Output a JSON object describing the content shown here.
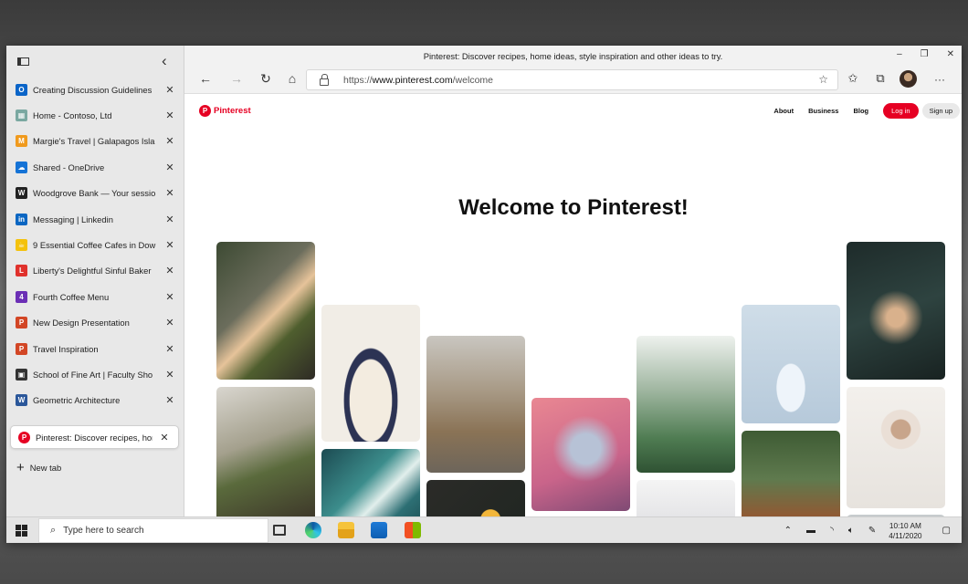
{
  "window": {
    "title": "Pinterest: Discover recipes, home ideas, style inspiration and other ideas to try.",
    "controls": {
      "minimize": "–",
      "maximize": "❐",
      "close": "✕"
    }
  },
  "sidebar": {
    "collapse_glyph": "‹",
    "tabs": [
      {
        "label": "Creating Discussion Guidelines",
        "icon": "outlook-icon",
        "color": "#0a64c8",
        "glyph": "O"
      },
      {
        "label": "Home - Contoso, Ltd",
        "icon": "contoso-icon",
        "color": "#7aa8a1",
        "glyph": "▦"
      },
      {
        "label": "Margie's Travel | Galapagos Isla",
        "icon": "margies-travel-icon",
        "color": "#f09a1d",
        "glyph": "M"
      },
      {
        "label": "Shared - OneDrive",
        "icon": "onedrive-icon",
        "color": "#1573d6",
        "glyph": "☁"
      },
      {
        "label": "Woodgrove Bank — Your sessio",
        "icon": "woodgrove-icon",
        "color": "#222222",
        "glyph": "W"
      },
      {
        "label": "Messaging | Linkedin",
        "icon": "linkedin-icon",
        "color": "#0a66c2",
        "glyph": "in"
      },
      {
        "label": "9 Essential Coffee Cafes in Dow",
        "icon": "coffee-icon",
        "color": "#f4c20d",
        "glyph": "☕"
      },
      {
        "label": "Liberty's Delightful Sinful Baker",
        "icon": "liberty-icon",
        "color": "#e0312c",
        "glyph": "L"
      },
      {
        "label": "Fourth Coffee Menu",
        "icon": "fourth-coffee-icon",
        "color": "#6b2fb5",
        "glyph": "4"
      },
      {
        "label": "New Design Presentation",
        "icon": "powerpoint-icon",
        "color": "#d24625",
        "glyph": "P"
      },
      {
        "label": "Travel Inspiration",
        "icon": "powerpoint-icon",
        "color": "#d24625",
        "glyph": "P"
      },
      {
        "label": "School of Fine Art | Faculty Sho",
        "icon": "fine-art-icon",
        "color": "#333333",
        "glyph": "▣"
      },
      {
        "label": "Geometric Architecture",
        "icon": "word-icon",
        "color": "#2b579a",
        "glyph": "W"
      }
    ],
    "active_tab": {
      "label": "Pinterest: Discover recipes, hom",
      "icon": "pinterest-icon",
      "color": "#e60023",
      "glyph": "P"
    },
    "new_tab_label": "New tab",
    "close_glyph": "✕"
  },
  "toolbar": {
    "back": "←",
    "forward": "→",
    "refresh": "↻",
    "home": "⌂",
    "url_prefix": "https://",
    "url_host": "www.pinterest.com",
    "url_path": "/welcome",
    "favorite_glyph": "☆",
    "favorites_glyph": "✩",
    "collections_glyph": "⧉",
    "more_glyph": "···"
  },
  "pinterest": {
    "brand": "Pinterest",
    "nav": [
      "About",
      "Business",
      "Blog"
    ],
    "login": "Log in",
    "signup": "Sign up",
    "heading": "Welcome to Pinterest!"
  },
  "taskbar": {
    "search_placeholder": "Type here to search",
    "time": "10:10 AM",
    "date": "4/11/2020"
  }
}
